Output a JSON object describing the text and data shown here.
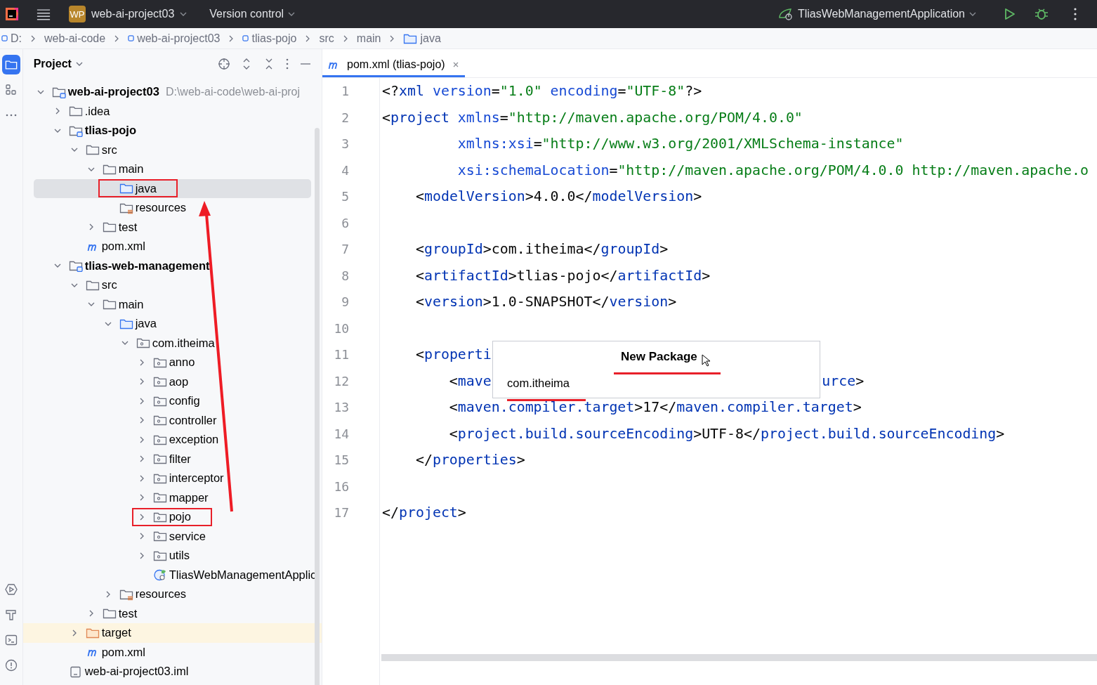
{
  "top_bar": {
    "project_badge": "WP",
    "project_name": "web-ai-project03",
    "vcs_menu": "Version control",
    "run_config": "TliasWebManagementApplication"
  },
  "breadcrumbs": [
    {
      "label": "D:",
      "kind": "module"
    },
    {
      "label": "web-ai-code",
      "kind": "plain"
    },
    {
      "label": "web-ai-project03",
      "kind": "module"
    },
    {
      "label": "tlias-pojo",
      "kind": "module"
    },
    {
      "label": "src",
      "kind": "plain"
    },
    {
      "label": "main",
      "kind": "plain"
    },
    {
      "label": "java",
      "kind": "source"
    }
  ],
  "tool_strip": {
    "top": [
      {
        "kind": "project",
        "selected": true
      },
      {
        "kind": "structure",
        "selected": false
      },
      {
        "kind": "more",
        "selected": false
      }
    ],
    "bottom": [
      {
        "kind": "services"
      },
      {
        "kind": "build"
      },
      {
        "kind": "terminal"
      },
      {
        "kind": "problems"
      }
    ]
  },
  "project_panel": {
    "title": "Project",
    "tree": [
      {
        "name": "web-ai-project03",
        "path": "D:\\web-ai-code\\web-ai-proj",
        "kind": "module",
        "expanded": true,
        "selected": false,
        "marked": false,
        "children": [
          {
            "name": ".idea",
            "kind": "folder",
            "expanded": false,
            "selected": false,
            "marked": false
          },
          {
            "name": "tlias-pojo",
            "kind": "module",
            "expanded": true,
            "selected": false,
            "marked": false,
            "children": [
              {
                "name": "src",
                "kind": "folder",
                "expanded": true,
                "selected": false,
                "marked": false,
                "children": [
                  {
                    "name": "main",
                    "kind": "folder",
                    "expanded": true,
                    "selected": false,
                    "marked": false,
                    "children": [
                      {
                        "name": "java",
                        "kind": "source",
                        "selected": true,
                        "marked": true
                      },
                      {
                        "name": "resources",
                        "kind": "resources",
                        "selected": false,
                        "marked": false
                      }
                    ]
                  },
                  {
                    "name": "test",
                    "kind": "folder",
                    "expanded": false,
                    "selected": false,
                    "marked": false
                  }
                ]
              },
              {
                "name": "pom.xml",
                "kind": "maven",
                "selected": false,
                "marked": false
              }
            ]
          },
          {
            "name": "tlias-web-management",
            "kind": "module",
            "expanded": true,
            "selected": false,
            "marked": false,
            "children": [
              {
                "name": "src",
                "kind": "folder",
                "expanded": true,
                "selected": false,
                "marked": false,
                "children": [
                  {
                    "name": "main",
                    "kind": "folder",
                    "expanded": true,
                    "selected": false,
                    "marked": false,
                    "children": [
                      {
                        "name": "java",
                        "kind": "source",
                        "expanded": true,
                        "selected": false,
                        "marked": false,
                        "children": [
                          {
                            "name": "com.itheima",
                            "kind": "package",
                            "expanded": true,
                            "selected": false,
                            "marked": false,
                            "children": [
                              {
                                "name": "anno",
                                "kind": "package",
                                "expanded": false,
                                "selected": false,
                                "marked": false
                              },
                              {
                                "name": "aop",
                                "kind": "package",
                                "expanded": false,
                                "selected": false,
                                "marked": false
                              },
                              {
                                "name": "config",
                                "kind": "package",
                                "expanded": false,
                                "selected": false,
                                "marked": false
                              },
                              {
                                "name": "controller",
                                "kind": "package",
                                "expanded": false,
                                "selected": false,
                                "marked": false
                              },
                              {
                                "name": "exception",
                                "kind": "package",
                                "expanded": false,
                                "selected": false,
                                "marked": false
                              },
                              {
                                "name": "filter",
                                "kind": "package",
                                "expanded": false,
                                "selected": false,
                                "marked": false
                              },
                              {
                                "name": "interceptor",
                                "kind": "package",
                                "expanded": false,
                                "selected": false,
                                "marked": false
                              },
                              {
                                "name": "mapper",
                                "kind": "package",
                                "expanded": false,
                                "selected": false,
                                "marked": false
                              },
                              {
                                "name": "pojo",
                                "kind": "package",
                                "expanded": false,
                                "selected": false,
                                "marked": true
                              },
                              {
                                "name": "service",
                                "kind": "package",
                                "expanded": false,
                                "selected": false,
                                "marked": false
                              },
                              {
                                "name": "utils",
                                "kind": "package",
                                "expanded": false,
                                "selected": false,
                                "marked": false
                              },
                              {
                                "name": "TliasWebManagementApplic",
                                "kind": "app",
                                "selected": false,
                                "marked": false
                              }
                            ]
                          }
                        ]
                      },
                      {
                        "name": "resources",
                        "kind": "resources",
                        "expanded": false,
                        "selected": false,
                        "marked": false
                      }
                    ]
                  },
                  {
                    "name": "test",
                    "kind": "folder",
                    "expanded": false,
                    "selected": false,
                    "marked": false
                  }
                ]
              },
              {
                "name": "target",
                "kind": "excluded",
                "expanded": false,
                "selected": false,
                "marked": false
              },
              {
                "name": "pom.xml",
                "kind": "maven",
                "selected": false,
                "marked": false
              }
            ]
          },
          {
            "name": "web-ai-project03.iml",
            "kind": "iml",
            "selected": false,
            "marked": false
          }
        ]
      }
    ]
  },
  "editor": {
    "tab": {
      "label": "pom.xml (tlias-pojo)",
      "selected": true
    },
    "lines": [
      {
        "number": "1",
        "tokens": [
          {
            "kind": "p",
            "text": "<?"
          },
          {
            "kind": "tag",
            "text": "xml"
          },
          {
            "kind": "attr",
            "text": " version"
          },
          {
            "kind": "p",
            "text": "="
          },
          {
            "kind": "val",
            "text": "\"1.0\""
          },
          {
            "kind": "attr",
            "text": " encoding"
          },
          {
            "kind": "p",
            "text": "="
          },
          {
            "kind": "val",
            "text": "\"UTF-8\""
          },
          {
            "kind": "p",
            "text": "?>"
          }
        ]
      },
      {
        "number": "2",
        "tokens": [
          {
            "kind": "p",
            "text": "<"
          },
          {
            "kind": "tag",
            "text": "project"
          },
          {
            "kind": "attr",
            "text": " xmlns"
          },
          {
            "kind": "p",
            "text": "="
          },
          {
            "kind": "val",
            "text": "\"http://maven.apache.org/POM/4.0.0\""
          }
        ]
      },
      {
        "number": "3",
        "tokens": [
          {
            "kind": "attr",
            "text": "         xmlns:xsi"
          },
          {
            "kind": "p",
            "text": "="
          },
          {
            "kind": "val",
            "text": "\"http://www.w3.org/2001/XMLSchema-instance\""
          }
        ]
      },
      {
        "number": "4",
        "tokens": [
          {
            "kind": "attr",
            "text": "         xsi:schemaLocation"
          },
          {
            "kind": "p",
            "text": "="
          },
          {
            "kind": "val",
            "text": "\"http://maven.apache.org/POM/4.0.0 http://maven.apache.o"
          }
        ]
      },
      {
        "number": "5",
        "tokens": [
          {
            "kind": "p",
            "text": "    <"
          },
          {
            "kind": "tag",
            "text": "modelVersion"
          },
          {
            "kind": "p",
            "text": ">"
          },
          {
            "kind": "txt",
            "text": "4.0.0"
          },
          {
            "kind": "p",
            "text": "</"
          },
          {
            "kind": "tag",
            "text": "modelVersion"
          },
          {
            "kind": "p",
            "text": ">"
          }
        ]
      },
      {
        "number": "6"
      },
      {
        "number": "7",
        "tokens": [
          {
            "kind": "p",
            "text": "    <"
          },
          {
            "kind": "tag",
            "text": "groupId"
          },
          {
            "kind": "p",
            "text": ">"
          },
          {
            "kind": "txt",
            "text": "com.itheima"
          },
          {
            "kind": "p",
            "text": "</"
          },
          {
            "kind": "tag",
            "text": "groupId"
          },
          {
            "kind": "p",
            "text": ">"
          }
        ]
      },
      {
        "number": "8",
        "tokens": [
          {
            "kind": "p",
            "text": "    <"
          },
          {
            "kind": "tag",
            "text": "artifactId"
          },
          {
            "kind": "p",
            "text": ">"
          },
          {
            "kind": "txt",
            "text": "tlias-pojo"
          },
          {
            "kind": "p",
            "text": "</"
          },
          {
            "kind": "tag",
            "text": "artifactId"
          },
          {
            "kind": "p",
            "text": ">"
          }
        ]
      },
      {
        "number": "9",
        "tokens": [
          {
            "kind": "p",
            "text": "    <"
          },
          {
            "kind": "tag",
            "text": "version"
          },
          {
            "kind": "p",
            "text": ">"
          },
          {
            "kind": "txt",
            "text": "1.0-SNAPSHOT"
          },
          {
            "kind": "p",
            "text": "</"
          },
          {
            "kind": "tag",
            "text": "version"
          },
          {
            "kind": "p",
            "text": ">"
          }
        ]
      },
      {
        "number": "10"
      },
      {
        "number": "11",
        "tokens": [
          {
            "kind": "p",
            "text": "    <"
          },
          {
            "kind": "tag",
            "text": "properti"
          }
        ]
      },
      {
        "number": "12",
        "tokens": [
          {
            "kind": "p",
            "text": "        <"
          },
          {
            "kind": "tag",
            "text": "mave"
          }
        ],
        "tokens_after_dialog": [
          {
            "kind": "tag",
            "text": "urce"
          },
          {
            "kind": "p",
            "text": ">"
          }
        ]
      },
      {
        "number": "13",
        "tokens": [
          {
            "kind": "p",
            "text": "        <"
          },
          {
            "kind": "tag",
            "text": "maven.compiler.target"
          },
          {
            "kind": "p",
            "text": ">"
          },
          {
            "kind": "txt",
            "text": "17"
          },
          {
            "kind": "p",
            "text": "</"
          },
          {
            "kind": "tag",
            "text": "maven.compiler.target"
          },
          {
            "kind": "p",
            "text": ">"
          }
        ]
      },
      {
        "number": "14",
        "tokens": [
          {
            "kind": "p",
            "text": "        <"
          },
          {
            "kind": "tag",
            "text": "project.build.sourceEncoding"
          },
          {
            "kind": "p",
            "text": ">"
          },
          {
            "kind": "txt",
            "text": "UTF-8"
          },
          {
            "kind": "p",
            "text": "</"
          },
          {
            "kind": "tag",
            "text": "project.build.sourceEncoding"
          },
          {
            "kind": "p",
            "text": ">"
          }
        ]
      },
      {
        "number": "15",
        "tokens": [
          {
            "kind": "p",
            "text": "    </"
          },
          {
            "kind": "tag",
            "text": "properties"
          },
          {
            "kind": "p",
            "text": ">"
          }
        ]
      },
      {
        "number": "16"
      },
      {
        "number": "17",
        "tokens": [
          {
            "kind": "p",
            "text": "</"
          },
          {
            "kind": "tag",
            "text": "project"
          },
          {
            "kind": "p",
            "text": ">"
          }
        ]
      }
    ]
  },
  "dialog": {
    "title": "New Package",
    "title_marked": true,
    "value": "com.itheima",
    "value_marked": true
  }
}
